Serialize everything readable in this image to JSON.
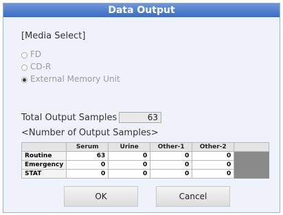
{
  "title": "Data Output",
  "media_select": {
    "label": "[Media Select]",
    "options": [
      {
        "label": "FD",
        "selected": false,
        "enabled": false
      },
      {
        "label": "CD-R",
        "selected": false,
        "enabled": false
      },
      {
        "label": "External Memory Unit",
        "selected": true,
        "enabled": true
      }
    ]
  },
  "total": {
    "label": "Total Output Samples",
    "value": "63"
  },
  "samples": {
    "label": "<Number of Output Samples>",
    "columns": [
      "",
      "Serum",
      "Urine",
      "Other-1",
      "Other-2",
      ""
    ],
    "rows": [
      {
        "name": "Routine",
        "values": [
          "63",
          "0",
          "0",
          "0"
        ]
      },
      {
        "name": "Emergency",
        "values": [
          "0",
          "0",
          "0",
          "0"
        ]
      },
      {
        "name": "STAT",
        "values": [
          "0",
          "0",
          "0",
          "0"
        ]
      }
    ]
  },
  "buttons": {
    "ok": "OK",
    "cancel": "Cancel"
  }
}
